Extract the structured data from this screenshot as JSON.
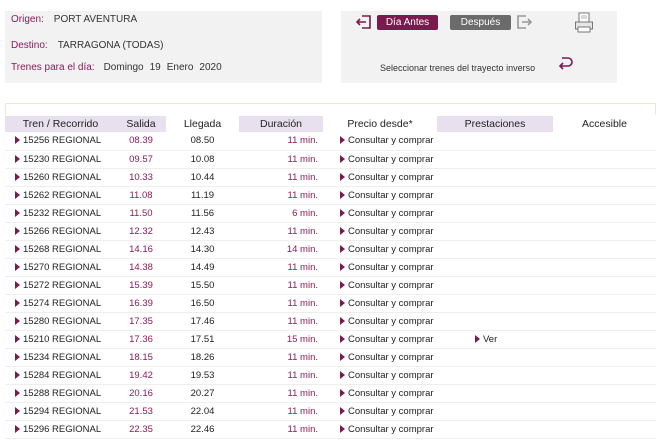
{
  "search": {
    "origen_label": "Origen:",
    "origen_value": "PORT AVENTURA",
    "destino_label": "Destino:",
    "destino_value": "TARRAGONA (TODAS)",
    "fecha_label": "Trenes para el día:",
    "fecha_dia": "Domingo",
    "fecha_num": "19",
    "fecha_mes": "Enero",
    "fecha_anio": "2020"
  },
  "nav": {
    "dia_antes_label": "Día Antes",
    "despues_label": "Después",
    "inverse_label": "Seleccionar trenes del trayecto inverso"
  },
  "table": {
    "headers": [
      "Tren / Recorrido",
      "Salida",
      "Llegada",
      "Duración",
      "Precio desde*",
      "Prestaciones",
      "Accesible"
    ],
    "rows": [
      {
        "train": "15256 REGIONAL",
        "salida": "08.39",
        "llegada": "08.50",
        "duracion": "11 min.",
        "precio": "Consultar y comprar",
        "prestaciones": ""
      },
      {
        "train": "15230 REGIONAL",
        "salida": "09.57",
        "llegada": "10.08",
        "duracion": "11 min.",
        "precio": "Consultar y comprar",
        "prestaciones": ""
      },
      {
        "train": "15260 REGIONAL",
        "salida": "10.33",
        "llegada": "10.44",
        "duracion": "11 min.",
        "precio": "Consultar y comprar",
        "prestaciones": ""
      },
      {
        "train": "15262 REGIONAL",
        "salida": "11.08",
        "llegada": "11.19",
        "duracion": "11 min.",
        "precio": "Consultar y comprar",
        "prestaciones": ""
      },
      {
        "train": "15232 REGIONAL",
        "salida": "11.50",
        "llegada": "11.56",
        "duracion": "6 min.",
        "precio": "Consultar y comprar",
        "prestaciones": ""
      },
      {
        "train": "15266 REGIONAL",
        "salida": "12.32",
        "llegada": "12.43",
        "duracion": "11 min.",
        "precio": "Consultar y comprar",
        "prestaciones": ""
      },
      {
        "train": "15268 REGIONAL",
        "salida": "14.16",
        "llegada": "14.30",
        "duracion": "14 min.",
        "precio": "Consultar y comprar",
        "prestaciones": ""
      },
      {
        "train": "15270 REGIONAL",
        "salida": "14.38",
        "llegada": "14.49",
        "duracion": "11 min.",
        "precio": "Consultar y comprar",
        "prestaciones": ""
      },
      {
        "train": "15272 REGIONAL",
        "salida": "15.39",
        "llegada": "15.50",
        "duracion": "11 min.",
        "precio": "Consultar y comprar",
        "prestaciones": ""
      },
      {
        "train": "15274 REGIONAL",
        "salida": "16.39",
        "llegada": "16.50",
        "duracion": "11 min.",
        "precio": "Consultar y comprar",
        "prestaciones": ""
      },
      {
        "train": "15280 REGIONAL",
        "salida": "17.35",
        "llegada": "17.46",
        "duracion": "11 min.",
        "precio": "Consultar y comprar",
        "prestaciones": ""
      },
      {
        "train": "15210 REGIONAL",
        "salida": "17.36",
        "llegada": "17.51",
        "duracion": "15 min.",
        "precio": "Consultar y comprar",
        "prestaciones": "Ver"
      },
      {
        "train": "15234 REGIONAL",
        "salida": "18.15",
        "llegada": "18.26",
        "duracion": "11 min.",
        "precio": "Consultar y comprar",
        "prestaciones": ""
      },
      {
        "train": "15284 REGIONAL",
        "salida": "19.42",
        "llegada": "19.53",
        "duracion": "11 min.",
        "precio": "Consultar y comprar",
        "prestaciones": ""
      },
      {
        "train": "15288 REGIONAL",
        "salida": "20.16",
        "llegada": "20.27",
        "duracion": "11 min.",
        "precio": "Consultar y comprar",
        "prestaciones": ""
      },
      {
        "train": "15294 REGIONAL",
        "salida": "21.53",
        "llegada": "22.04",
        "duracion": "11 min.",
        "precio": "Consultar y comprar",
        "prestaciones": ""
      },
      {
        "train": "15296 REGIONAL",
        "salida": "22.35",
        "llegada": "22.46",
        "duracion": "11 min.",
        "precio": "Consultar y comprar",
        "prestaciones": ""
      }
    ]
  },
  "colors": {
    "accent": "#7a1a4e",
    "label": "#8b1a5a",
    "header_shade": "#e8e0ee",
    "panel_bg": "#f2f2f2"
  },
  "icons": {
    "prev_day": "exit-left-icon",
    "next_day": "exit-right-icon",
    "print": "print-icon",
    "inverse": "return-arrow-icon",
    "row_link": "triangle-right-icon"
  }
}
